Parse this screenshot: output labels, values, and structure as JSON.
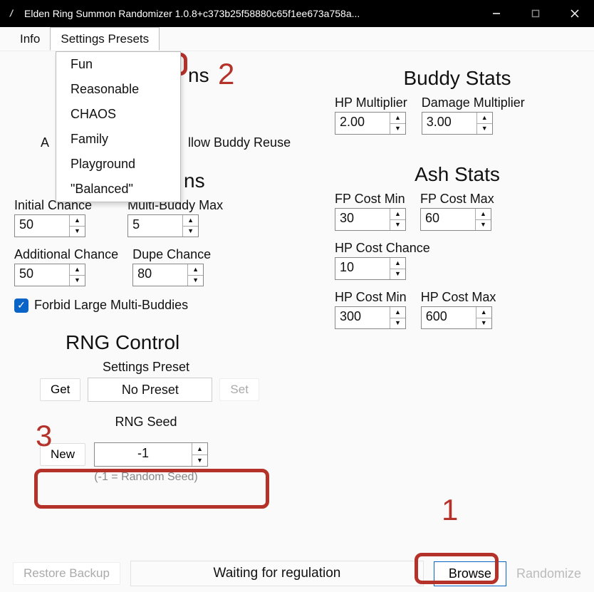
{
  "window": {
    "title": "Elden Ring Summon Randomizer 1.0.8+c373b25f58880c65f1ee673a758a..."
  },
  "menu": {
    "info": "Info",
    "settings_presets": "Settings Presets",
    "dropdown": [
      "Fun",
      "Reasonable",
      "CHAOS",
      "Family",
      "Playground",
      "\"Balanced\""
    ]
  },
  "left": {
    "partial_heading_suffix": "ns",
    "allow_buddy_reuse": "llow Buddy Reuse",
    "multi_heading": "Multi-Summons",
    "initial_chance": {
      "label": "Initial Chance",
      "value": "50"
    },
    "multi_buddy_max": {
      "label": "Multi-Buddy Max",
      "value": "5"
    },
    "additional_chance": {
      "label": "Additional Chance",
      "value": "50"
    },
    "dupe_chance": {
      "label": "Dupe Chance",
      "value": "80"
    },
    "forbid_label": "Forbid Large Multi-Buddies",
    "rng_heading": "RNG Control",
    "settings_preset_label": "Settings Preset",
    "get_btn": "Get",
    "preset_value": "No Preset",
    "set_btn": "Set",
    "rng_seed_label": "RNG Seed",
    "new_btn": "New",
    "seed_value": "-1",
    "seed_hint": "(-1 = Random Seed)"
  },
  "right": {
    "buddy_heading": "Buddy Stats",
    "hp_mult": {
      "label": "HP Multiplier",
      "value": "2.00"
    },
    "dmg_mult": {
      "label": "Damage Multiplier",
      "value": "3.00"
    },
    "ash_heading": "Ash Stats",
    "fp_min": {
      "label": "FP Cost Min",
      "value": "30"
    },
    "fp_max": {
      "label": "FP Cost Max",
      "value": "60"
    },
    "hp_chance": {
      "label": "HP Cost Chance",
      "value": "10"
    },
    "hp_min": {
      "label": "HP Cost Min",
      "value": "300"
    },
    "hp_max": {
      "label": "HP Cost Max",
      "value": "600"
    }
  },
  "bottom": {
    "restore": "Restore Backup",
    "status": "Waiting for regulation",
    "browse": "Browse",
    "randomize": "Randomize"
  },
  "annotations": {
    "one": "1",
    "two": "2",
    "three": "3"
  }
}
